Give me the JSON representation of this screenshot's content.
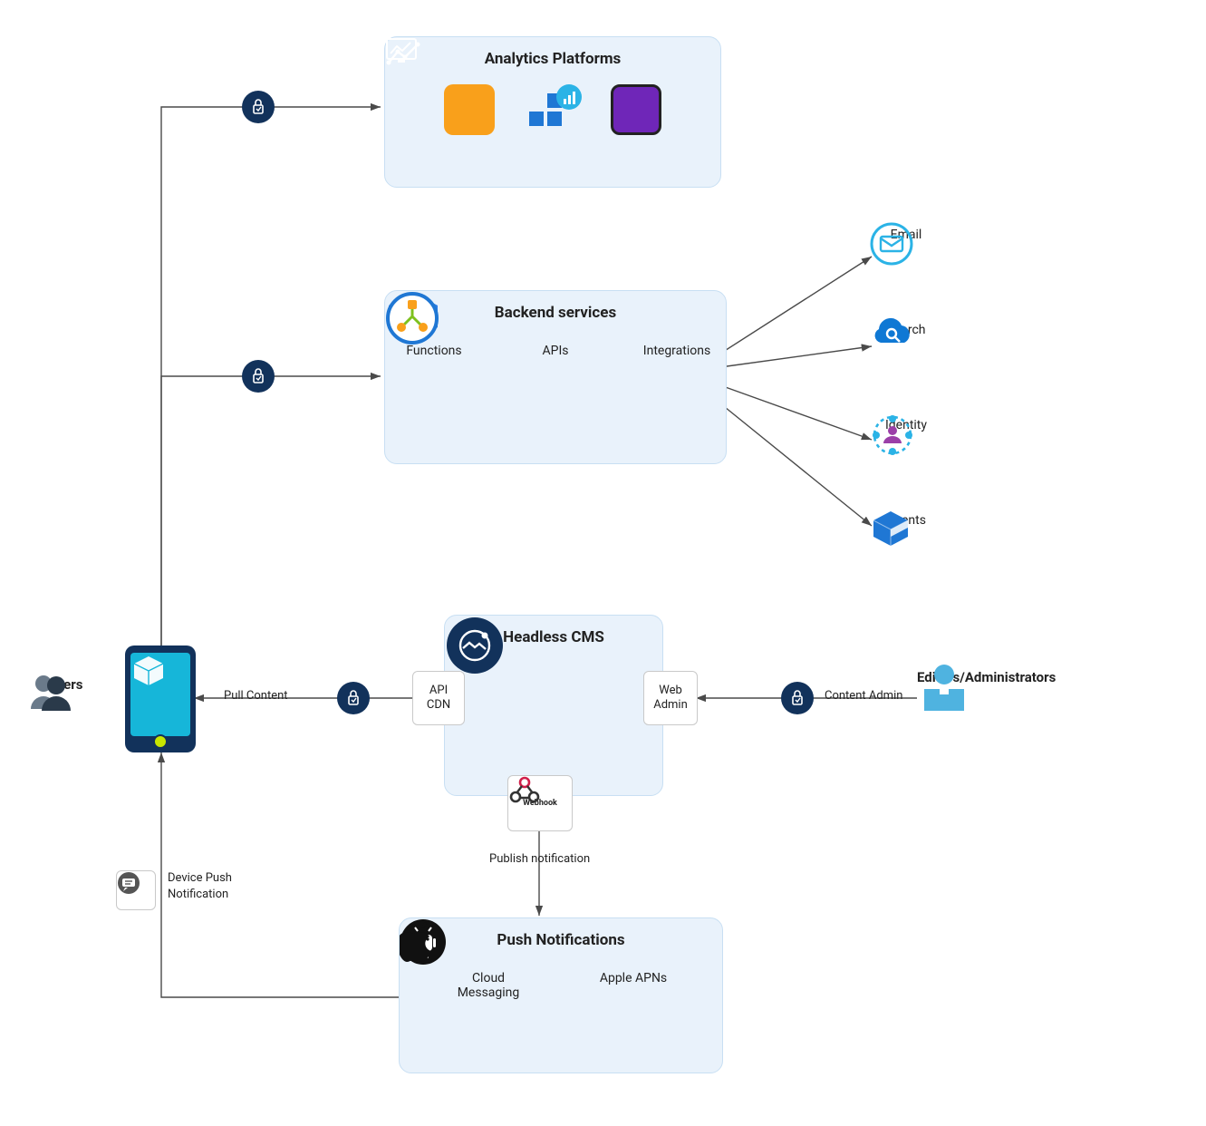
{
  "boxes": {
    "analytics": {
      "title": "Analytics Platforms"
    },
    "backend": {
      "title": "Backend services",
      "items": [
        "Functions",
        "APIs",
        "Integrations"
      ]
    },
    "cms": {
      "title": "Headless CMS"
    },
    "push": {
      "title": "Push Notifications",
      "items": [
        "Cloud Messaging",
        "Apple APNs"
      ]
    }
  },
  "side": {
    "email": "Email",
    "search": "Search",
    "identity": "Identity",
    "agents": "Agents"
  },
  "mini": {
    "apiCdn": "API\nCDN",
    "webAdmin": "Web\nAdmin",
    "webhook": "Webhook"
  },
  "labels": {
    "users": "Users",
    "editors": "Editors/Administrators",
    "pullContent": "Pull Content",
    "contentAdmin": "Content Admin",
    "publishNotif": "Publish notification",
    "devicePush": "Device Push\nNotification"
  },
  "colors": {
    "boxFill": "#e9f2fb",
    "boxBorder": "#c8dff3",
    "navy": "#12325b",
    "arrow": "#4a4a4a",
    "orange": "#f9a01b",
    "blue1": "#1f77d4",
    "blue2": "#3b8be6",
    "purple": "#6f26b8",
    "cyan": "#2bb3e6",
    "green": "#7ec11e",
    "msBlue": "#1f77d4",
    "cloud": "#0f78d4",
    "box3d": "#1f77d4",
    "black": "#111"
  }
}
